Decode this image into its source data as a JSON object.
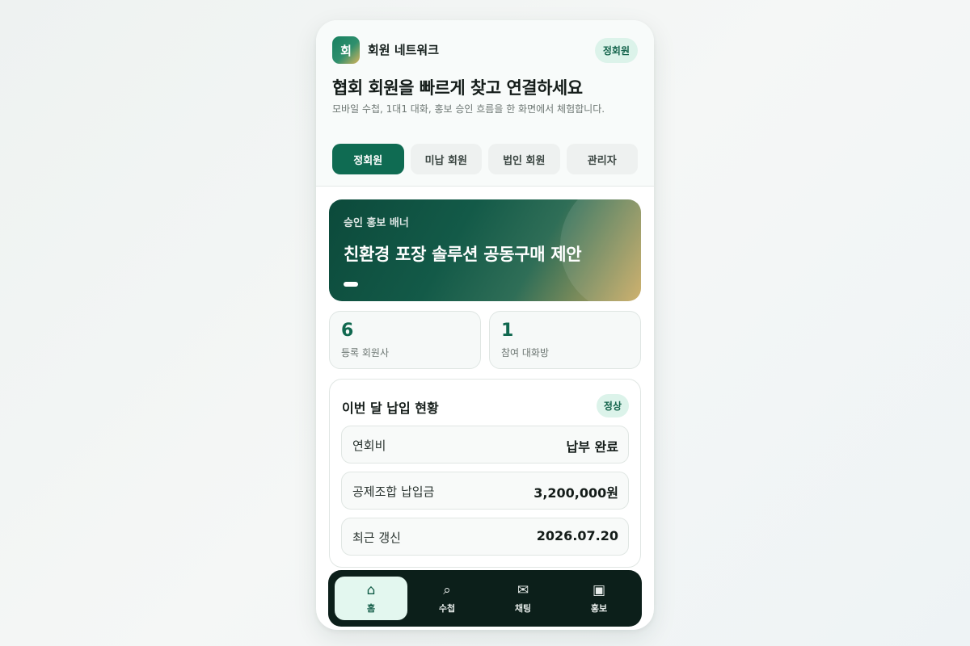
{
  "app": {
    "logo_text": "회",
    "name": "회원 네트워크",
    "member_badge": "정회원"
  },
  "hero": {
    "headline": "협회 회원을 빠르게 찾고 연결하세요",
    "subline": "모바일 수첩, 1대1 대화, 홍보 승인 흐름을 한 화면에서 체험합니다."
  },
  "tabs": [
    {
      "label": "정회원",
      "active": true
    },
    {
      "label": "미납 회원",
      "active": false
    },
    {
      "label": "법인 회원",
      "active": false
    },
    {
      "label": "관리자",
      "active": false
    }
  ],
  "banner": {
    "label": "승인 홍보 배너",
    "title": "친환경 포장 솔루션 공동구매 제안"
  },
  "stats": [
    {
      "value": "6",
      "label": "등록 회원사"
    },
    {
      "value": "1",
      "label": "참여 대화방"
    }
  ],
  "status": {
    "title": "이번 달 납입 현황",
    "badge": "정상",
    "rows": [
      {
        "label": "연회비",
        "value": "납부 완료"
      },
      {
        "label": "공제조합 납입금",
        "value": "3,200,000원"
      },
      {
        "label": "최근 갱신",
        "value": "2026.07.20"
      }
    ]
  },
  "nav": [
    {
      "icon": "home-icon",
      "glyph": "⌂",
      "label": "홈",
      "active": true
    },
    {
      "icon": "search-icon",
      "glyph": "⌕",
      "label": "수첩",
      "active": false
    },
    {
      "icon": "mail-icon",
      "glyph": "✉",
      "label": "채팅",
      "active": false
    },
    {
      "icon": "image-icon",
      "glyph": "▣",
      "label": "홍보",
      "active": false
    }
  ],
  "colors": {
    "accent": "#0f6b52",
    "badge_bg": "#dcf3ea",
    "nav_bg": "#0c1f1a"
  }
}
